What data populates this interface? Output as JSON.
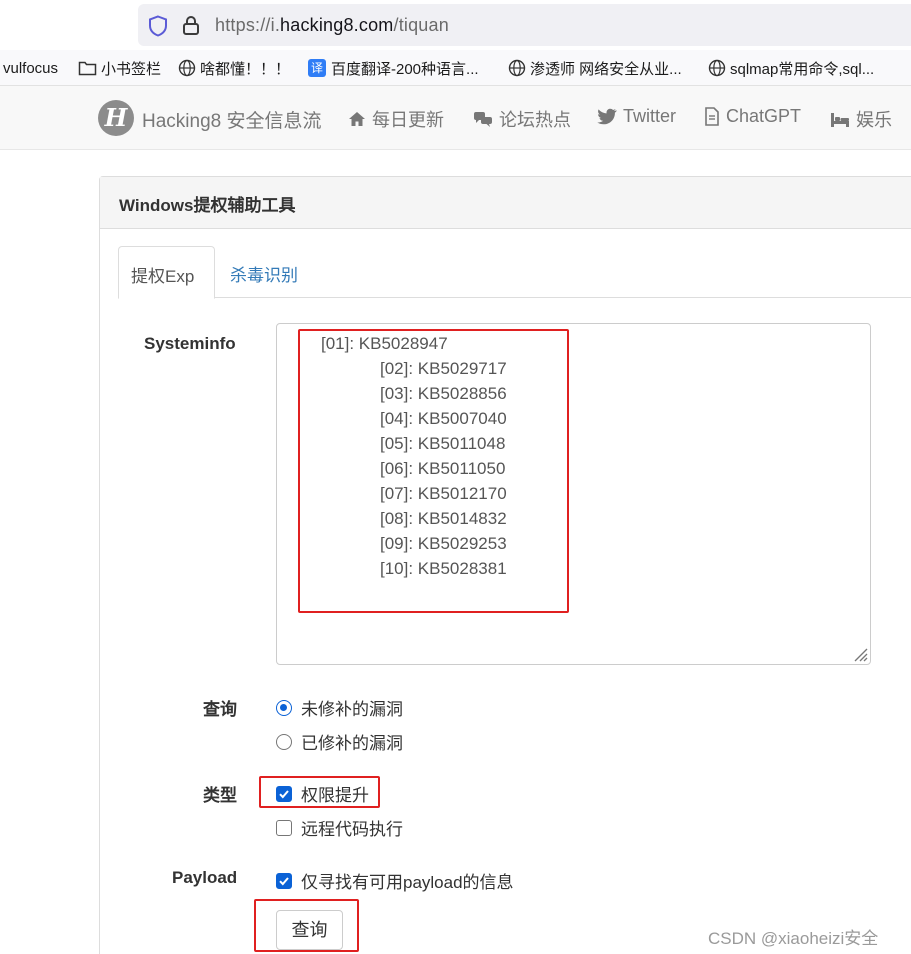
{
  "browser": {
    "url_prefix": "https://i.",
    "url_domain": "hacking8.com",
    "url_path": "/tiquan",
    "bookmarks": [
      {
        "label": "vulfocus",
        "icon": "none"
      },
      {
        "label": "小书签栏",
        "icon": "folder-icon"
      },
      {
        "label": "啥都懂！！！",
        "icon": "globe-icon"
      },
      {
        "label": "百度翻译-200种语言...",
        "icon": "translate-icon",
        "badge": "译"
      },
      {
        "label": "渗透师 网络安全从业...",
        "icon": "globe-icon"
      },
      {
        "label": "sqlmap常用命令,sql...",
        "icon": "globe-icon"
      }
    ]
  },
  "site": {
    "logo_letter": "H",
    "brand": "Hacking8 安全信息流",
    "nav": [
      {
        "label": "每日更新",
        "icon": "home-icon"
      },
      {
        "label": "论坛热点",
        "icon": "comments-icon"
      },
      {
        "label": "Twitter",
        "icon": "twitter-icon"
      },
      {
        "label": "ChatGPT",
        "icon": "file-icon"
      },
      {
        "label": "娱乐",
        "icon": "bed-icon"
      }
    ]
  },
  "panel": {
    "title": "Windows提权辅助工具",
    "tabs": [
      {
        "label": "提权Exp",
        "active": true
      },
      {
        "label": "杀毒识别",
        "active": false
      }
    ],
    "systeminfo_label": "Systeminfo",
    "systeminfo_lines": [
      "[01]: KB5028947",
      "[02]: KB5029717",
      "[03]: KB5028856",
      "[04]: KB5007040",
      "[05]: KB5011048",
      "[06]: KB5011050",
      "[07]: KB5012170",
      "[08]: KB5014832",
      "[09]: KB5029253",
      "[10]: KB5028381"
    ],
    "query_label": "查询",
    "query_options": [
      {
        "label": "未修补的漏洞",
        "selected": true
      },
      {
        "label": "已修补的漏洞",
        "selected": false
      }
    ],
    "type_label": "类型",
    "type_options": [
      {
        "label": "权限提升",
        "checked": true
      },
      {
        "label": "远程代码执行",
        "checked": false
      }
    ],
    "payload_label": "Payload",
    "payload_option": {
      "label": "仅寻找有可用payload的信息",
      "checked": true
    },
    "submit_label": "查询"
  },
  "watermark": "CSDN @xiaoheizi安全",
  "colors": {
    "annotation_red": "#e02020",
    "link_blue": "#337ab7",
    "control_blue": "#0b62d6"
  }
}
